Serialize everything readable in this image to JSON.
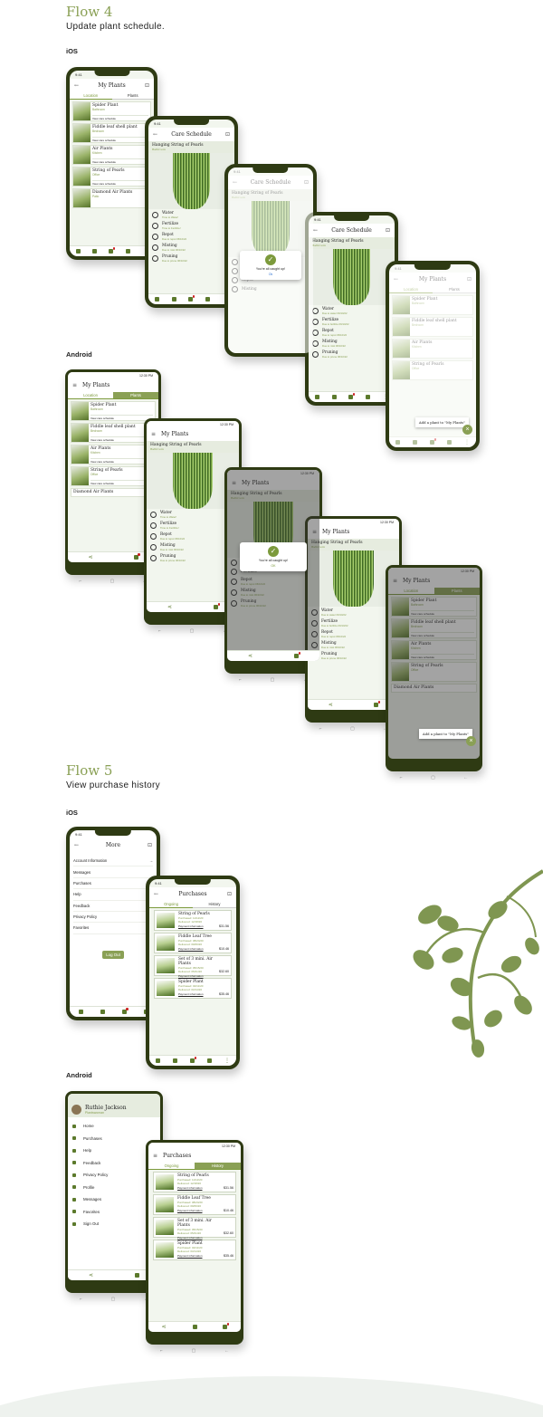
{
  "flow4": {
    "title": "Flow 4",
    "subtitle": "Update plant schedule.",
    "ios": "iOS",
    "android": "Android"
  },
  "flow5": {
    "title": "Flow 5",
    "subtitle": "View purchase history",
    "ios": "iOS",
    "android": "Android"
  },
  "status": {
    "time": "9:41",
    "and_time": "12:30 PM"
  },
  "my_plants": {
    "title": "My Plants",
    "tabs": [
      "Location",
      "Plants"
    ],
    "items": [
      {
        "name": "Spider Plant",
        "loc": "Bathroom",
        "link": "View care schedule"
      },
      {
        "name": "Fiddle leaf shell plant",
        "loc": "Bedroom",
        "link": "View care schedule"
      },
      {
        "name": "Air Plants",
        "loc": "Kitchen",
        "link": "View care schedule"
      },
      {
        "name": "String of Pearls",
        "loc": "Office",
        "link": "View care schedule"
      },
      {
        "name": "Diamond Air Plants",
        "loc": "Patio",
        "link": "View care schedule"
      }
    ],
    "add_popup": "Add a plant to \"My Plants\"",
    "fab": "+",
    "close": "×"
  },
  "care": {
    "title": "Care Schedule",
    "plant": "Hanging String of Pearls",
    "loc": "Bathroom",
    "tasks": [
      {
        "name": "Water",
        "sub": "Time to Water!"
      },
      {
        "name": "Fertilize",
        "sub": "Time to Fertilize!"
      },
      {
        "name": "Repot",
        "sub": "Due to repot 06/10/22"
      },
      {
        "name": "Misting",
        "sub": "Due to mist 06/10/22"
      },
      {
        "name": "Pruning",
        "sub": "Due to prune 06/10/22"
      }
    ],
    "done_tasks": [
      {
        "name": "Water",
        "sub": "Due to water 06/10/22"
      },
      {
        "name": "Fertilize",
        "sub": "Due to fertilize 06/10/22"
      },
      {
        "name": "Repot",
        "sub": "Due to repot 06/10/22"
      },
      {
        "name": "Misting",
        "sub": "Due to mist 06/10/22"
      },
      {
        "name": "Pruning",
        "sub": "Due to prune 06/10/22"
      }
    ]
  },
  "dialog": {
    "message": "You're all caught up!",
    "ok": "Ok",
    "ok_and": "OK"
  },
  "more": {
    "title": "More",
    "items": [
      "Account Information",
      "Messages",
      "Purchases",
      "Help",
      "Feedback",
      "Privacy Policy",
      "Favorites"
    ],
    "logout": "Log Out"
  },
  "purchases": {
    "title": "Purchases",
    "tabs": [
      "Ongoing",
      "History"
    ],
    "items": [
      {
        "name": "String of Pearls",
        "p1": "Purchased: 11/12/20",
        "p2": "Delivered: 12/18/20",
        "info": "Payment information",
        "price": "$31.56"
      },
      {
        "name": "Fiddle Leaf Tree",
        "p1": "Purchased: 08/24/20",
        "p2": "Delivered: 09/06/20",
        "info": "Payment information",
        "price": "$10.46"
      },
      {
        "name": "Set of 3 mini. Air Plants",
        "p1": "Purchased: 05/15/20",
        "p2": "Delivered: 05/21/20",
        "info": "Payment information",
        "price": "$32.60"
      },
      {
        "name": "Spider Plant",
        "p1": "Purchased: 02/11/20",
        "p2": "Delivered: 03/14/20",
        "info": "Payment information",
        "price": "$35.46"
      }
    ]
  },
  "drawer": {
    "name": "Ruthie Jackson",
    "role": "Plantswoman",
    "items": [
      "Home",
      "Purchases",
      "Help",
      "Feedback",
      "Privacy Policy",
      "Profile",
      "Messages",
      "Favorites",
      "Sign Out"
    ]
  },
  "colors": {
    "accent": "#8aa055",
    "frame": "#2e3a13",
    "leaf": "#7f9651"
  },
  "icons": [
    "back-arrow-icon",
    "cart-icon",
    "home-icon",
    "person-icon",
    "notification-icon",
    "more-icon",
    "menu-icon",
    "share-icon",
    "check-icon"
  ]
}
